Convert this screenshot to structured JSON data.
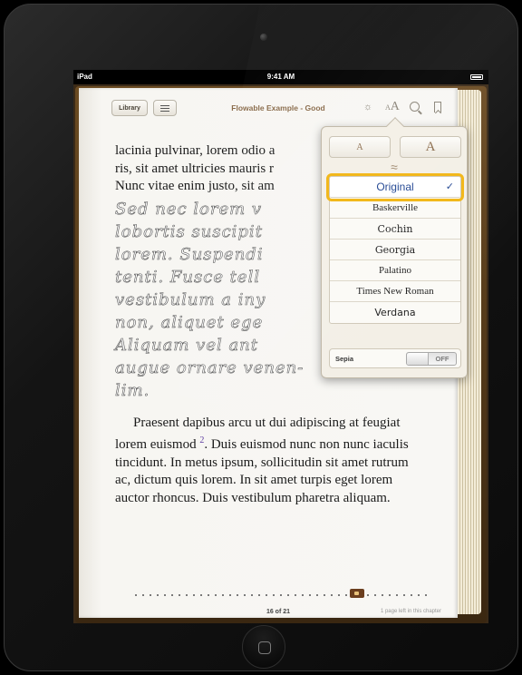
{
  "statusbar": {
    "device": "iPad",
    "time": "9:41 AM"
  },
  "toolbar": {
    "library_label": "Library",
    "book_title": "Flowable Example - Good",
    "icons": [
      "list-icon",
      "brightness-icon",
      "font-size-icon",
      "search-icon",
      "bookmark-icon"
    ]
  },
  "book": {
    "para1_lines": [
      "lacinia pulvinar, lorem odio a",
      "ris, sit amet ultricies mauris r",
      "Nunc vitae enim justo, sit am"
    ],
    "script_text": "Sed nec lorem v\nlobortis suscipit\nlorem. Suspendi\ntenti. Fusce tell\nvestibulum a iny\nnon, aliquet ege\nAliquam vel ant\naugue ornare venen-\nlim.",
    "para2_before_note": "Praesent dapibus arcu ut dui adipiscing at feugiat lorem euismod ",
    "footnote": "2",
    "para2_after_note": ". Duis euismod nunc non nunc iaculis tincidunt. In metus ipsum, sollicitudin sit amet rutrum ac, dictum quis lorem. In sit amet turpis eget lorem auctor rhoncus. Duis vestibulum pharetra aliquam."
  },
  "footer": {
    "page_number": "16 of 21",
    "pages_left": "1 page left in this chapter",
    "progress_fraction": 0.76
  },
  "popover": {
    "small_size_label": "A",
    "large_size_label": "A",
    "ornament": "≈",
    "fonts": [
      "Original",
      "Baskerville",
      "Cochin",
      "Georgia",
      "Palatino",
      "Times New Roman",
      "Verdana"
    ],
    "selected_font": "Original",
    "check": "✓",
    "sepia_label": "Sepia",
    "sepia_state": "OFF"
  },
  "colors": {
    "selection_highlight": "#f2b81c",
    "selected_font_text": "#2a4d96",
    "title_text": "#8a6b4b"
  }
}
